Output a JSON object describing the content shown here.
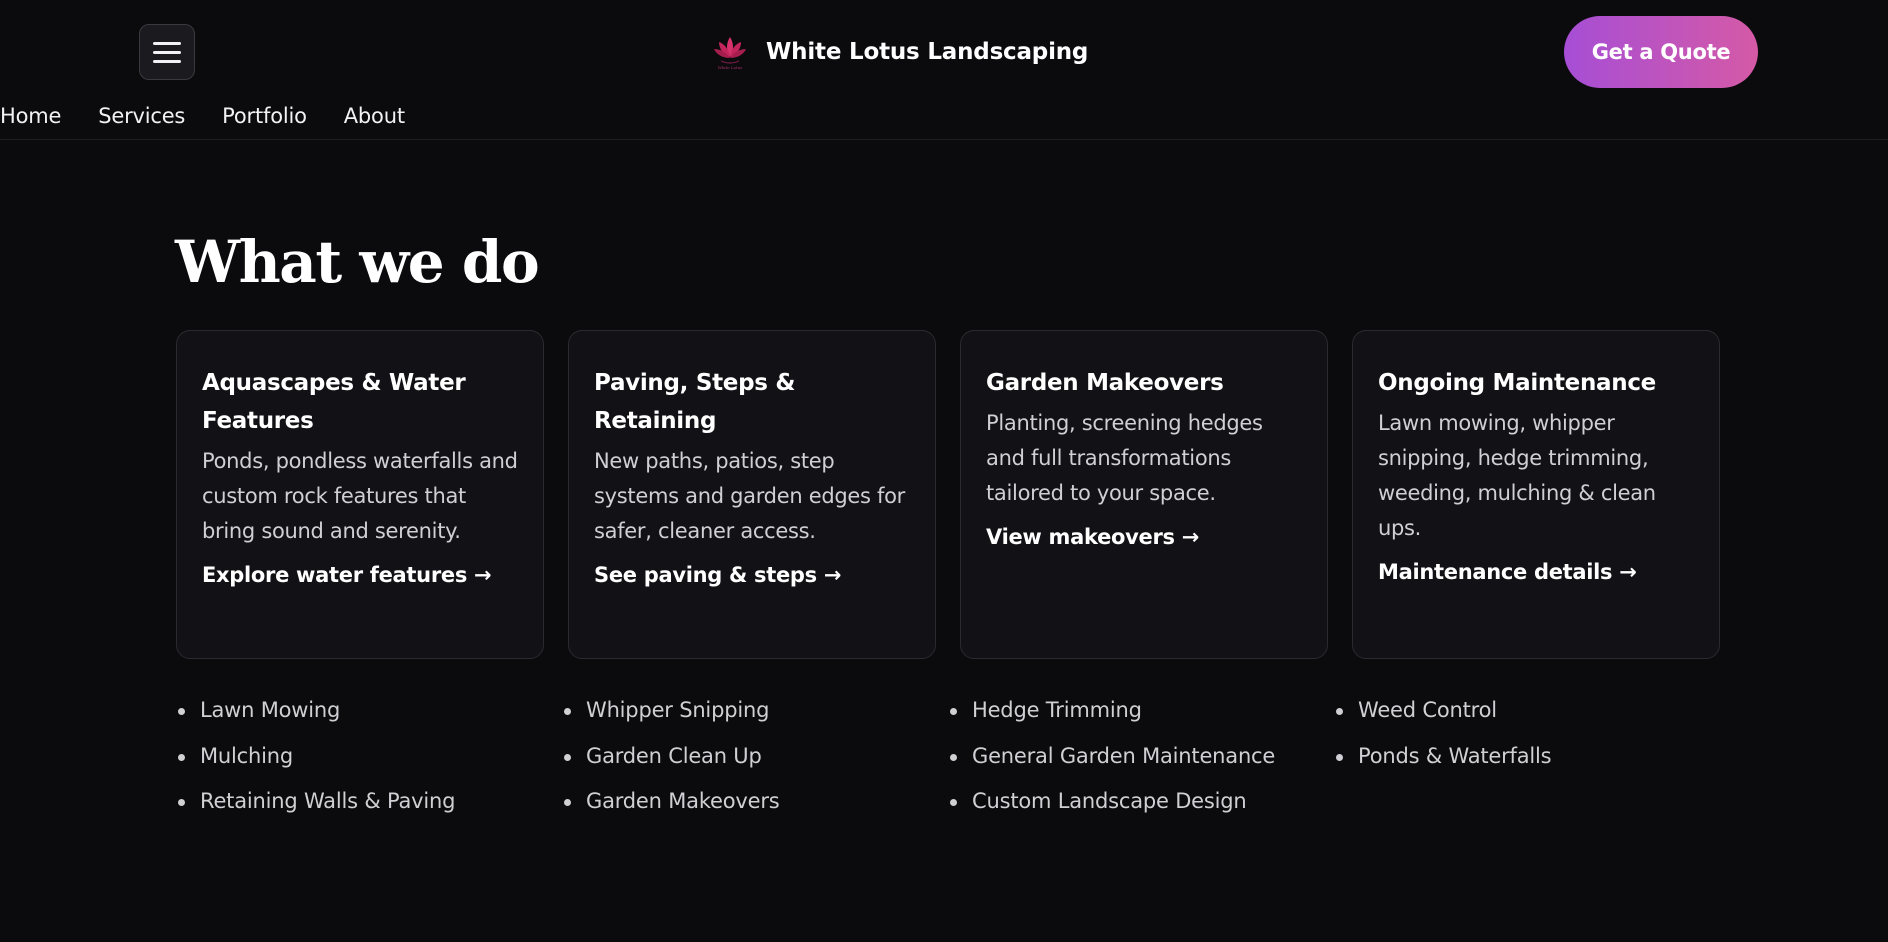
{
  "header": {
    "brand_name": "White Lotus Landscaping",
    "logo_text": "White Lotus",
    "quote_button": "Get a Quote",
    "nav": [
      "Home",
      "Services",
      "Portfolio",
      "About"
    ]
  },
  "section": {
    "title": "What we do",
    "cards": [
      {
        "title": "Aquascapes & Water Features",
        "description": "Ponds, pondless waterfalls and custom rock features that bring sound and serenity.",
        "link": "Explore water features →"
      },
      {
        "title": "Paving, Steps & Retaining",
        "description": "New paths, patios, step systems and garden edges for safer, cleaner access.",
        "link": "See paving & steps →"
      },
      {
        "title": "Garden Makeovers",
        "description": "Planting, screening hedges and full transformations tailored to your space.",
        "link": "View makeovers →"
      },
      {
        "title": "Ongoing Maintenance",
        "description": "Lawn mowing, whipper snipping, hedge trimming, weeding, mulching & clean ups.",
        "link": "Maintenance details →"
      }
    ],
    "service_columns": [
      [
        "Lawn Mowing",
        "Mulching",
        "Retaining Walls & Paving"
      ],
      [
        "Whipper Snipping",
        "Garden Clean Up",
        "Garden Makeovers"
      ],
      [
        "Hedge Trimming",
        "General Garden Maintenance",
        "Custom Landscape Design"
      ],
      [
        "Weed Control",
        "Ponds & Waterfalls"
      ]
    ]
  },
  "colors": {
    "background": "#0b0a0d",
    "card_background": "#121115",
    "accent_gradient_start": "#a64ed6",
    "accent_gradient_end": "#d55aa6",
    "logo_pink": "#d6336c"
  },
  "icons": {
    "menu": "hamburger-menu-icon",
    "logo": "lotus-flower-logo"
  }
}
